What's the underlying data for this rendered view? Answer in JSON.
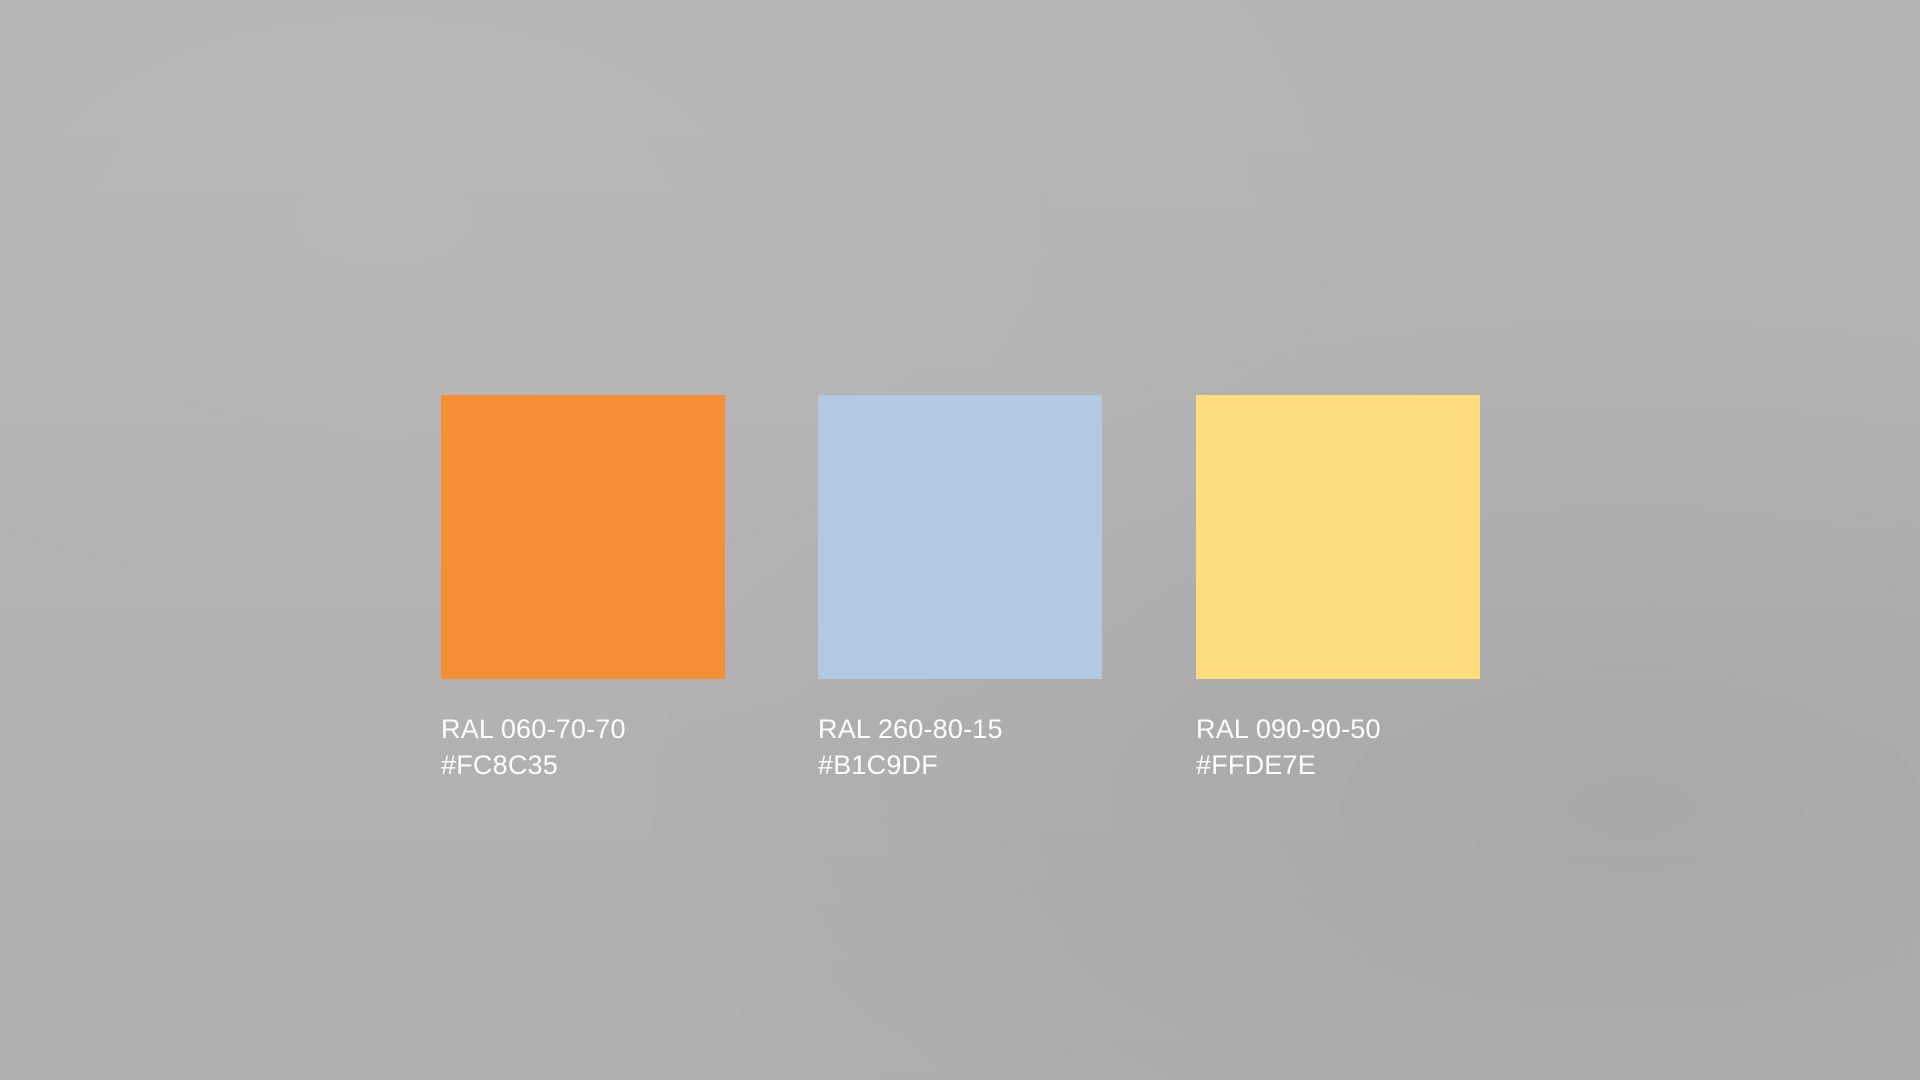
{
  "swatches": [
    {
      "ral": "RAL 060-70-70",
      "hex": "#FC8C35",
      "color": "#F68E36"
    },
    {
      "ral": "RAL 260-80-15",
      "hex": "#B1C9DF",
      "color": "#B3C8E3"
    },
    {
      "ral": "RAL 090-90-50",
      "hex": "#FFDE7E",
      "color": "#FEDE7C"
    }
  ],
  "colors": {
    "background": "#B3B3B3",
    "label_text": "#FFFFFF"
  }
}
